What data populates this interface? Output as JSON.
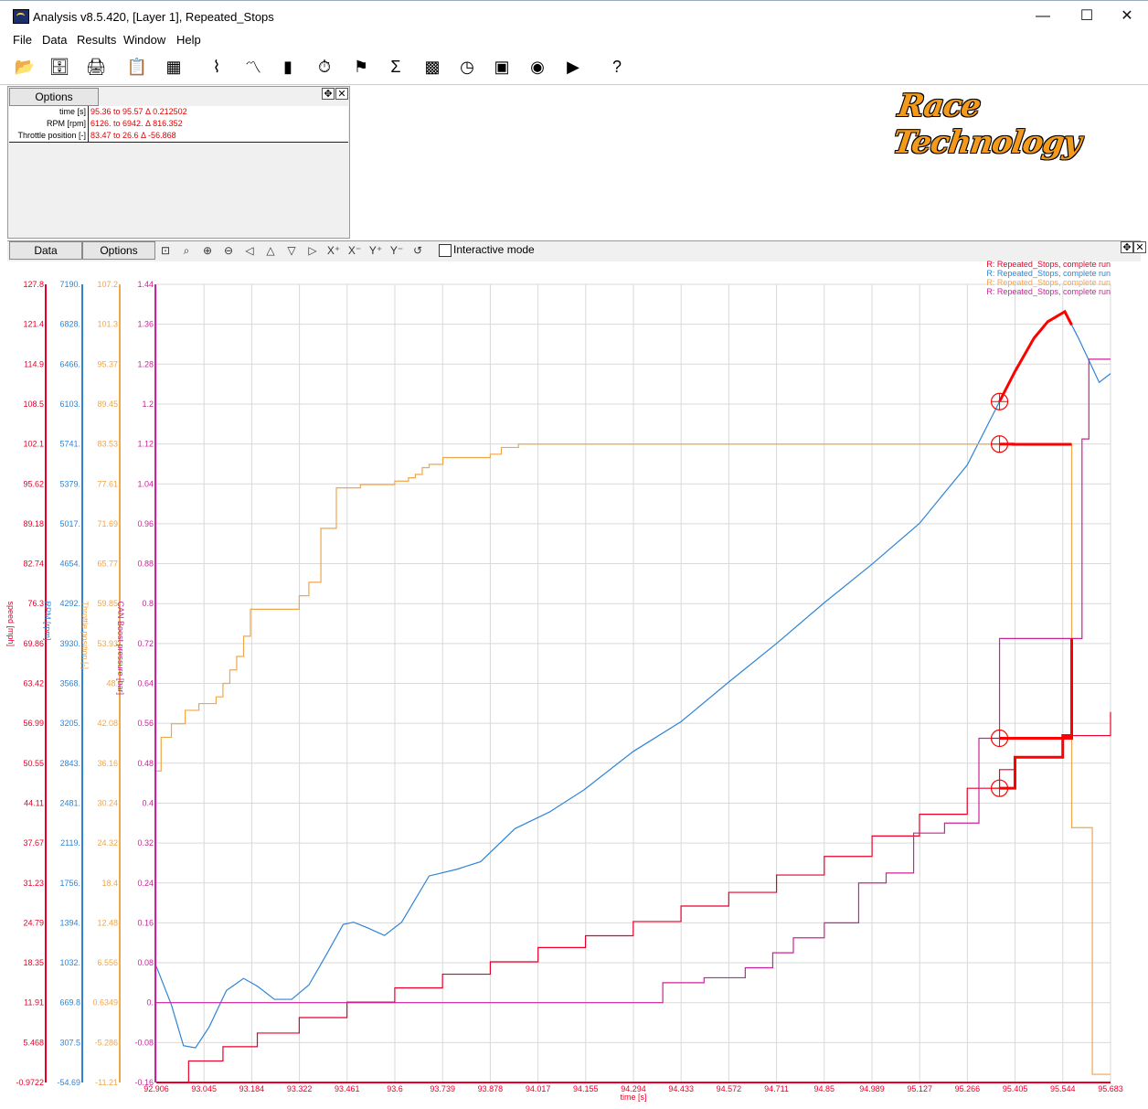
{
  "window": {
    "title": "Analysis v8.5.420, [Layer 1], Repeated_Stops",
    "minimize": "—",
    "maximize": "☐",
    "close": "✕"
  },
  "menu": [
    "File",
    "Data",
    "Results",
    "Window",
    "Help"
  ],
  "toolbar_icons": [
    "open-folder-icon",
    "database-icon",
    "printer-icon",
    "clipboard-icon",
    "excel-export-icon",
    "track-map-icon",
    "line-graph-icon",
    "bar-chart-icon",
    "stopwatch-icon",
    "checkered-flag-icon",
    "sigma-icon",
    "calculator-icon",
    "graph-clock-icon",
    "video-icon",
    "gauge-icon",
    "play-icon",
    "help-icon"
  ],
  "info_panel": {
    "tab": "Options",
    "rows": [
      {
        "label": "time [s]",
        "value": "95.36 to 95.57  Δ 0.212502"
      },
      {
        "label": "RPM [rpm]",
        "value": "6126. to 6942.  Δ 816.352"
      },
      {
        "label": "Throttle position [-]",
        "value": "83.47 to 26.6  Δ -56.868"
      }
    ]
  },
  "logo": "Race Technology",
  "graph_toolbar": {
    "tab_data": "Data",
    "tab_options": "Options",
    "interactive_label": "Interactive mode",
    "interactive_checked": false
  },
  "colors": {
    "speed": "#e8002a",
    "rpm": "#2f84d6",
    "throttle": "#f0a64a",
    "boost": "#cc2299",
    "cursor": "#ff0000"
  },
  "chart_data": {
    "type": "line",
    "xlabel": "time [s]",
    "x_ticks": [
      "92.906",
      "93.045",
      "93.184",
      "93.322",
      "93.461",
      "93.6",
      "93.739",
      "93.878",
      "94.017",
      "94.155",
      "94.294",
      "94.433",
      "94.572",
      "94.711",
      "94.85",
      "94.989",
      "95.127",
      "95.266",
      "95.405",
      "95.544",
      "95.683"
    ],
    "xlim": [
      92.906,
      95.683
    ],
    "axes": [
      {
        "name": "speed [mph]",
        "color": "#e8002a",
        "ticks": [
          "127.8",
          "121.4",
          "114.9",
          "108.5",
          "102.1",
          "95.62",
          "89.18",
          "82.74",
          "76.3",
          "69.86",
          "63.42",
          "56.99",
          "50.55",
          "44.11",
          "37.67",
          "31.23",
          "24.79",
          "18.35",
          "11.91",
          "5.468",
          "-0.9722"
        ],
        "ylim": [
          -0.9722,
          127.8
        ]
      },
      {
        "name": "RPM [rpm]",
        "color": "#2f84d6",
        "ticks": [
          "7190.",
          "6828.",
          "6466.",
          "6103.",
          "5741.",
          "5379.",
          "5017.",
          "4654.",
          "4292.",
          "3930.",
          "3568.",
          "3205.",
          "2843.",
          "2481.",
          "2119.",
          "1756.",
          "1394.",
          "1032.",
          "669.8",
          "307.5",
          "-54.69"
        ],
        "ylim": [
          -54.69,
          7190
        ]
      },
      {
        "name": "Throttle position [-]",
        "color": "#f0a64a",
        "ticks": [
          "107.2",
          "101.3",
          "95.37",
          "89.45",
          "83.53",
          "77.61",
          "71.69",
          "65.77",
          "59.85",
          "53.93",
          "48.",
          "42.08",
          "36.16",
          "30.24",
          "24.32",
          "18.4",
          "12.48",
          "6.556",
          "0.6349",
          "-5.286",
          "-11.21"
        ],
        "ylim": [
          -11.21,
          107.2
        ]
      },
      {
        "name": "CAN Boost pressure [bar]",
        "color": "#cc2299",
        "ticks": [
          "1.44",
          "1.36",
          "1.28",
          "1.2",
          "1.12",
          "1.04",
          "0.96",
          "0.88",
          "0.8",
          "0.72",
          "0.64",
          "0.56",
          "0.48",
          "0.4",
          "0.32",
          "0.24",
          "0.16",
          "0.08",
          "0.",
          "-0.08",
          "-0.16"
        ],
        "ylim": [
          -0.16,
          1.44
        ]
      }
    ],
    "legend": [
      {
        "text": "R:  Repeated_Stops, complete run",
        "color": "#e8002a"
      },
      {
        "text": "R:  Repeated_Stops, complete run",
        "color": "#2f84d6"
      },
      {
        "text": "R:  Repeated_Stops, complete run",
        "color": "#f0a64a"
      },
      {
        "text": "R:  Repeated_Stops, complete run",
        "color": "#cc2299"
      }
    ],
    "legend_position": "top-right",
    "grid": true,
    "series": [
      {
        "name": "speed [mph]",
        "axis": 0,
        "color": "#e8002a",
        "step": true,
        "points": [
          [
            92.906,
            -0.97
          ],
          [
            93.0,
            2.5
          ],
          [
            93.1,
            4.8
          ],
          [
            93.2,
            7.0
          ],
          [
            93.322,
            9.5
          ],
          [
            93.461,
            12.0
          ],
          [
            93.6,
            14.3
          ],
          [
            93.739,
            16.5
          ],
          [
            93.878,
            18.5
          ],
          [
            94.017,
            20.8
          ],
          [
            94.155,
            22.7
          ],
          [
            94.294,
            25.0
          ],
          [
            94.433,
            27.5
          ],
          [
            94.572,
            29.7
          ],
          [
            94.711,
            32.5
          ],
          [
            94.85,
            35.5
          ],
          [
            94.989,
            38.8
          ],
          [
            95.127,
            42.3
          ],
          [
            95.266,
            46.5
          ],
          [
            95.36,
            49.5
          ],
          [
            95.405,
            51.5
          ],
          [
            95.544,
            55.0
          ],
          [
            95.683,
            58.8
          ]
        ]
      },
      {
        "name": "RPM [rpm]",
        "axis": 1,
        "color": "#2f84d6",
        "step": false,
        "points": [
          [
            92.906,
            1000
          ],
          [
            92.95,
            650
          ],
          [
            92.985,
            280
          ],
          [
            93.02,
            260
          ],
          [
            93.06,
            450
          ],
          [
            93.11,
            780
          ],
          [
            93.16,
            890
          ],
          [
            93.2,
            820
          ],
          [
            93.25,
            700
          ],
          [
            93.3,
            700
          ],
          [
            93.35,
            830
          ],
          [
            93.4,
            1100
          ],
          [
            93.45,
            1380
          ],
          [
            93.48,
            1400
          ],
          [
            93.52,
            1350
          ],
          [
            93.57,
            1280
          ],
          [
            93.62,
            1400
          ],
          [
            93.7,
            1820
          ],
          [
            93.78,
            1880
          ],
          [
            93.85,
            1950
          ],
          [
            93.95,
            2250
          ],
          [
            94.05,
            2400
          ],
          [
            94.15,
            2600
          ],
          [
            94.294,
            2950
          ],
          [
            94.433,
            3220
          ],
          [
            94.572,
            3580
          ],
          [
            94.711,
            3930
          ],
          [
            94.85,
            4300
          ],
          [
            94.989,
            4650
          ],
          [
            95.127,
            5020
          ],
          [
            95.266,
            5550
          ],
          [
            95.36,
            6126
          ],
          [
            95.405,
            6400
          ],
          [
            95.46,
            6700
          ],
          [
            95.5,
            6850
          ],
          [
            95.55,
            6942
          ],
          [
            95.59,
            6700
          ],
          [
            95.62,
            6500
          ],
          [
            95.65,
            6300
          ],
          [
            95.683,
            6380
          ]
        ]
      },
      {
        "name": "Throttle position [-]",
        "axis": 2,
        "color": "#f0a64a",
        "step": true,
        "points": [
          [
            92.906,
            35
          ],
          [
            92.92,
            40
          ],
          [
            92.95,
            42
          ],
          [
            92.99,
            44
          ],
          [
            93.03,
            45
          ],
          [
            93.08,
            46
          ],
          [
            93.1,
            48
          ],
          [
            93.12,
            50
          ],
          [
            93.14,
            52
          ],
          [
            93.16,
            55
          ],
          [
            93.18,
            59
          ],
          [
            93.22,
            59
          ],
          [
            93.322,
            61
          ],
          [
            93.35,
            63
          ],
          [
            93.385,
            71
          ],
          [
            93.43,
            77
          ],
          [
            93.5,
            77.5
          ],
          [
            93.6,
            78
          ],
          [
            93.64,
            78.5
          ],
          [
            93.66,
            79
          ],
          [
            93.68,
            80
          ],
          [
            93.7,
            80.5
          ],
          [
            93.74,
            81.5
          ],
          [
            93.878,
            82
          ],
          [
            93.91,
            83
          ],
          [
            93.96,
            83.5
          ],
          [
            95.36,
            83.47
          ],
          [
            95.4,
            83.47
          ],
          [
            95.57,
            26.6
          ],
          [
            95.62,
            26.6
          ],
          [
            95.63,
            -10
          ],
          [
            95.683,
            -10
          ]
        ]
      },
      {
        "name": "CAN Boost pressure [bar]",
        "axis": 3,
        "color": "#cc2299",
        "step": true,
        "points": [
          [
            92.906,
            0
          ],
          [
            94.35,
            0
          ],
          [
            94.38,
            0.04
          ],
          [
            94.5,
            0.05
          ],
          [
            94.62,
            0.07
          ],
          [
            94.7,
            0.1
          ],
          [
            94.76,
            0.13
          ],
          [
            94.85,
            0.16
          ],
          [
            94.95,
            0.24
          ],
          [
            95.03,
            0.26
          ],
          [
            95.11,
            0.34
          ],
          [
            95.2,
            0.36
          ],
          [
            95.3,
            0.53
          ],
          [
            95.36,
            0.73
          ],
          [
            95.6,
            1.13
          ],
          [
            95.62,
            1.29
          ],
          [
            95.683,
            1.29
          ]
        ]
      }
    ],
    "cursors": [
      95.36,
      95.57
    ]
  }
}
